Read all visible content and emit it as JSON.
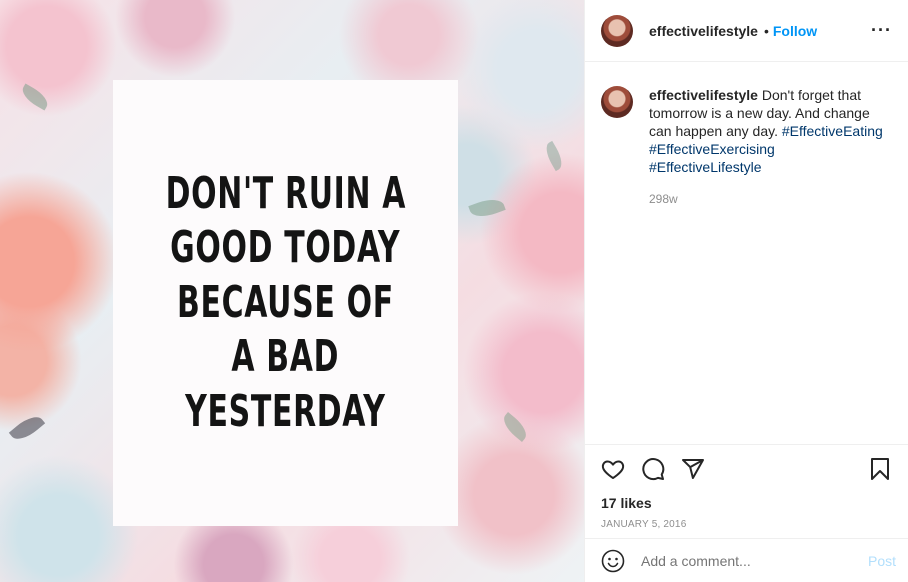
{
  "image": {
    "quote_lines": [
      "DON'T RUIN A",
      "GOOD TODAY",
      "BECAUSE OF",
      "A BAD",
      "YESTERDAY"
    ]
  },
  "header": {
    "username": "effectivelifestyle",
    "separator": "•",
    "follow_label": "Follow",
    "more_label": "···"
  },
  "caption": {
    "username": "effectivelifestyle",
    "text": "Don't forget that tomorrow is a new day. And change can happen any day.",
    "hashtags": [
      "#EffectiveEating",
      "#EffectiveExercising",
      "#EffectiveLifestyle"
    ],
    "time": "298w"
  },
  "actions": {
    "icons": [
      "heart-icon",
      "comment-icon",
      "share-icon",
      "bookmark-icon"
    ],
    "likes": "17 likes",
    "date": "JANUARY 5, 2016"
  },
  "comment_box": {
    "placeholder": "Add a comment...",
    "post_label": "Post"
  },
  "colors": {
    "follow": "#0095f6",
    "hashtag": "#00376b",
    "post_disabled": "#b2dffc",
    "muted": "#8e8e8e"
  }
}
